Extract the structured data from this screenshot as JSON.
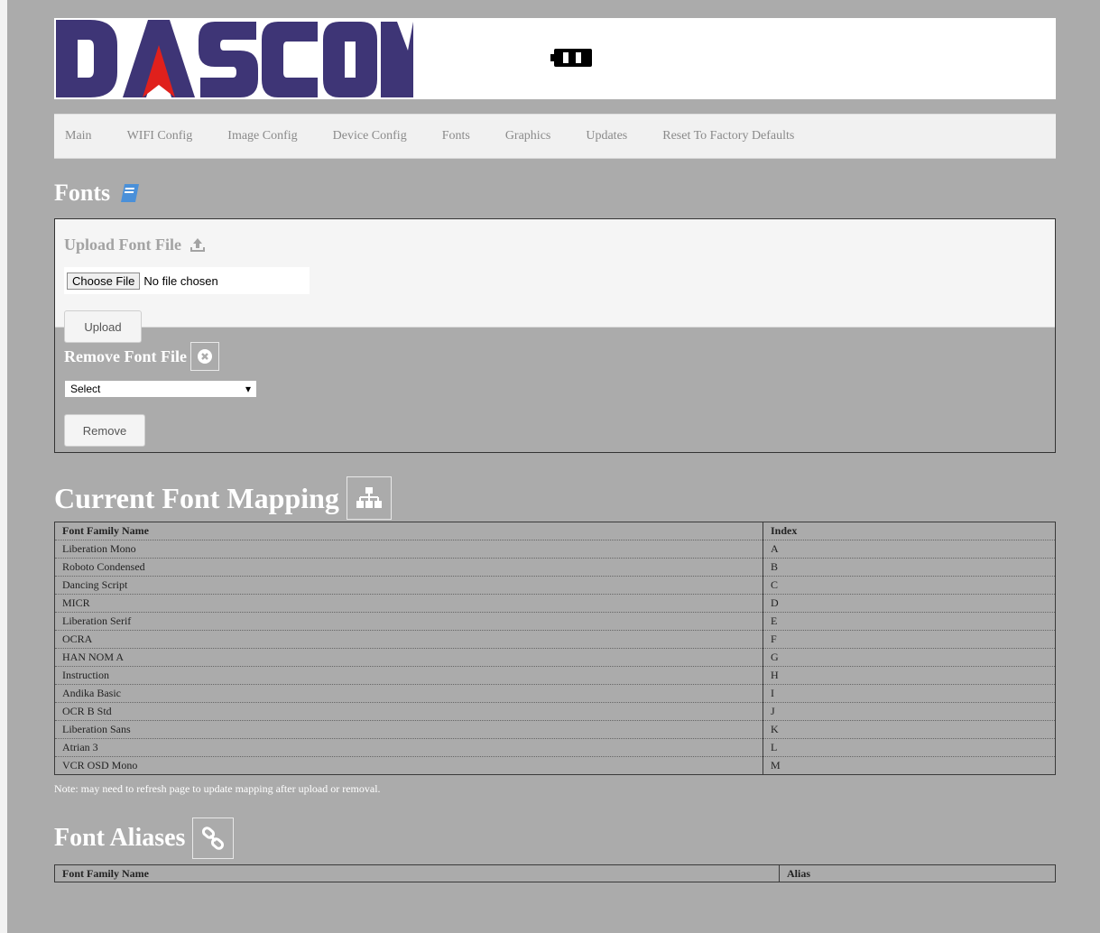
{
  "header": {
    "logo_text": "DASCOM",
    "battery_icon": "battery-icon"
  },
  "nav": {
    "items": [
      {
        "label": "Main"
      },
      {
        "label": "WIFI Config"
      },
      {
        "label": "Image Config"
      },
      {
        "label": "Device Config"
      },
      {
        "label": "Fonts"
      },
      {
        "label": "Graphics"
      },
      {
        "label": "Updates"
      },
      {
        "label": "Reset To Factory Defaults"
      }
    ]
  },
  "fonts_section": {
    "title": "Fonts",
    "icon": "book-icon",
    "upload": {
      "title": "Upload Font File",
      "icon": "upload-icon",
      "file_button": "Choose File",
      "file_status": "No file chosen",
      "button": "Upload"
    },
    "remove": {
      "title": "Remove Font File",
      "icon": "remove-circle-icon",
      "select_value": "Select",
      "button": "Remove"
    }
  },
  "mapping": {
    "title": "Current Font Mapping",
    "icon": "sitemap-icon",
    "columns": [
      "Font Family Name",
      "Index"
    ],
    "rows": [
      [
        "Liberation Mono",
        "A"
      ],
      [
        "Roboto Condensed",
        "B"
      ],
      [
        "Dancing Script",
        "C"
      ],
      [
        "MICR",
        "D"
      ],
      [
        "Liberation Serif",
        "E"
      ],
      [
        "OCRA",
        "F"
      ],
      [
        "HAN NOM A",
        "G"
      ],
      [
        "Instruction",
        "H"
      ],
      [
        "Andika Basic",
        "I"
      ],
      [
        "OCR B Std",
        "J"
      ],
      [
        "Liberation Sans",
        "K"
      ],
      [
        "Atrian 3",
        "L"
      ],
      [
        "VCR OSD Mono",
        "M"
      ]
    ],
    "note": "Note: may need to refresh page to update mapping after upload or removal."
  },
  "aliases": {
    "title": "Font Aliases",
    "icon": "link-icon",
    "columns": [
      "Font Family Name",
      "Alias"
    ]
  },
  "colors": {
    "logo_purple": "#3e3576",
    "logo_red": "#e0201c",
    "page_bg": "#ababab",
    "book_blue": "#4a90d9"
  }
}
